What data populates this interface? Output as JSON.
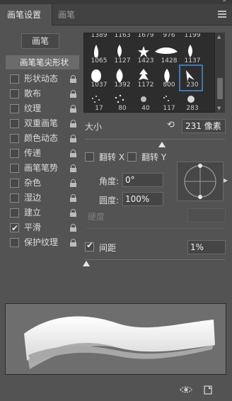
{
  "panel": {
    "collapse_glyph": "»",
    "menu_icon": "panel-menu-icon"
  },
  "tabs": [
    {
      "label": "画笔设置",
      "active": true
    },
    {
      "label": "画笔",
      "active": false
    }
  ],
  "left": {
    "presets_button": "画笔",
    "tip_shape": "画笔笔尖形状",
    "options": [
      {
        "label": "形状动态",
        "checked": false
      },
      {
        "label": "散布",
        "checked": false
      },
      {
        "label": "纹理",
        "checked": false
      },
      {
        "label": "双重画笔",
        "checked": false
      },
      {
        "label": "颜色动态",
        "checked": false
      },
      {
        "label": "传递",
        "checked": false
      },
      {
        "label": "画笔笔势",
        "checked": false
      },
      {
        "label": "杂色",
        "checked": false
      },
      {
        "label": "湿边",
        "checked": false
      },
      {
        "label": "建立",
        "checked": false
      },
      {
        "label": "平滑",
        "checked": true
      },
      {
        "label": "保护纹理",
        "checked": false
      }
    ]
  },
  "brush_grid": {
    "top_row_numbers": [
      "1389",
      "1163",
      "1679",
      "976",
      "1199"
    ],
    "row1": [
      "1065",
      "1127",
      "1423",
      "1428",
      "1137"
    ],
    "row2": [
      "1037",
      "1392",
      "1172",
      "800",
      "230"
    ],
    "row3": [
      "17",
      "80",
      "40",
      "117",
      "283"
    ],
    "selected": "230"
  },
  "size": {
    "label": "大小",
    "value": "231 像素",
    "slider_fraction": 0.55
  },
  "flip": {
    "x_label": "翻转 X",
    "y_label": "翻转 Y",
    "x_checked": false,
    "y_checked": false
  },
  "angle": {
    "label": "角度:",
    "value": "0°"
  },
  "roundness": {
    "label": "圆度:",
    "value": "100%"
  },
  "hardness": {
    "label": "硬度",
    "value": "",
    "enabled": false
  },
  "spacing": {
    "label": "间距",
    "value": "1%",
    "checked": true,
    "slider_fraction": 0.01
  },
  "bottom_icons": [
    "eye-dashed-icon",
    "new-preset-icon"
  ],
  "colors": {
    "accent": "#4a90d9",
    "panel_bg": "#535353",
    "grid_bg": "#2d2d2d"
  }
}
